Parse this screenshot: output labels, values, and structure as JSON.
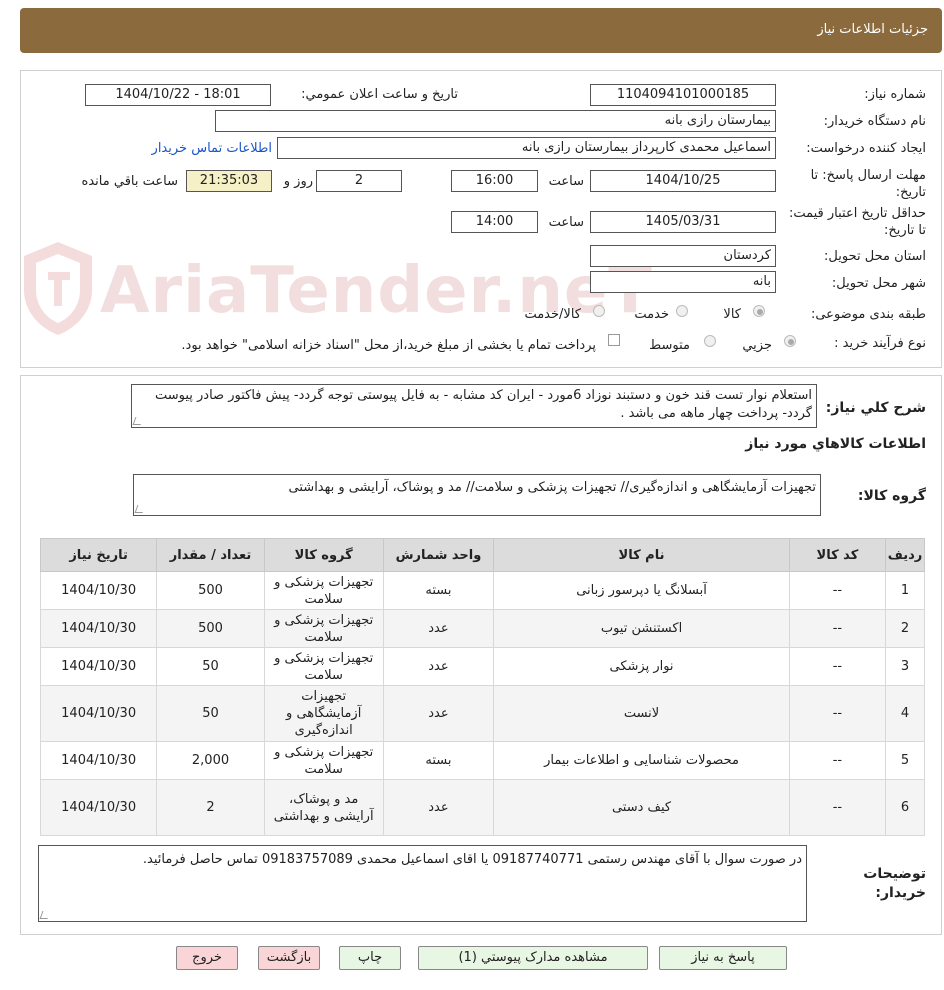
{
  "header": {
    "title": "جزئیات اطلاعات نیاز"
  },
  "watermark": {
    "text": "AriaTender.neT"
  },
  "form": {
    "need_number_label": "شماره نیاز:",
    "need_number": "1104094101000185",
    "announce_label": "تاریخ و ساعت اعلان عمومي:",
    "announce_value": "1404/10/22 - 18:01",
    "buyer_org_label": "نام دستگاه خریدار:",
    "buyer_org": "بیمارستان رازی بانه",
    "creator_label": "ایجاد کننده درخواست:",
    "creator": "اسماعیل محمدی کارپرداز بیمارستان رازی بانه",
    "contact_link": "اطلاعات تماس خریدار",
    "deadline_label": "مهلت ارسال پاسخ: تا تاریخ:",
    "deadline_date": "1404/10/25",
    "time_label": "ساعت",
    "deadline_time": "16:00",
    "days_value": "2",
    "days_label": "روز و",
    "remaining_time": "21:35:03",
    "remaining_label": "ساعت باقي مانده",
    "validity_label": "حداقل تاریخ اعتبار قیمت: تا تاریخ:",
    "validity_date": "1405/03/31",
    "validity_time": "14:00",
    "province_label": "استان محل تحویل:",
    "province": "کردستان",
    "city_label": "شهر محل تحویل:",
    "city": "بانه",
    "category_label": "طبقه بندی موضوعی:",
    "category_options": [
      "کالا",
      "خدمت",
      "کالا/خدمت"
    ],
    "process_label": "نوع فرآیند خرید :",
    "process_options": [
      "جزیي",
      "متوسط"
    ],
    "payment_note": "پرداخت تمام یا بخشی از مبلغ خرید،از محل \"اسناد خزانه اسلامی\" خواهد بود."
  },
  "description": {
    "label": "شرح کلي نیاز:",
    "text": "استعلام نوار تست قند خون و دستبند نوزاد 6مورد - ایران کد مشابه - به فایل پیوستی توجه گردد- پیش فاکتور صادر پیوست گردد-  پرداخت چهار ماهه می باشد ."
  },
  "goods": {
    "section_title": "اطلاعات کالاهاي مورد نیاز",
    "group_label": "گروه کالا:",
    "group_text": "تجهیزات آزمایشگاهی و اندازه‌گیری// تجهیزات پزشکی و سلامت// مد و پوشاک، آرایشی و بهداشتی"
  },
  "table": {
    "headers": [
      "ردیف",
      "کد کالا",
      "نام کالا",
      "واحد شمارش",
      "گروه کالا",
      "تعداد / مقدار",
      "تاریخ نیاز"
    ],
    "rows": [
      [
        "1",
        "--",
        "آبسلانگ یا دپرسور زبانی",
        "بسته",
        "تجهیزات پزشکی و سلامت",
        "500",
        "1404/10/30"
      ],
      [
        "2",
        "--",
        "اکستنشن تیوب",
        "عدد",
        "تجهیزات پزشکی و سلامت",
        "500",
        "1404/10/30"
      ],
      [
        "3",
        "--",
        "نوار پزشکی",
        "عدد",
        "تجهیزات پزشکی و سلامت",
        "50",
        "1404/10/30"
      ],
      [
        "4",
        "--",
        "لانست",
        "عدد",
        "تجهیزات آزمایشگاهی و اندازه‌گیری",
        "50",
        "1404/10/30"
      ],
      [
        "5",
        "--",
        "محصولات شناسایی و اطلاعات بیمار",
        "بسته",
        "تجهیزات پزشکی و سلامت",
        "2,000",
        "1404/10/30"
      ],
      [
        "6",
        "--",
        "کیف دستی",
        "عدد",
        "مد و پوشاک، آرایشی و بهداشتی",
        "2",
        "1404/10/30"
      ]
    ]
  },
  "buyer_notes": {
    "label": "توضیحات خریدار:",
    "text": "در صورت سوال با آقای مهندس رستمی 09187740771 یا اقای اسماعیل محمدی 09183757089 تماس حاصل فرمائید."
  },
  "buttons": {
    "reply": "پاسخ به نیاز",
    "attachments": "مشاهده مدارک پیوستي (1)",
    "print": "چاپ",
    "back": "بازگشت",
    "exit": "خروج"
  }
}
